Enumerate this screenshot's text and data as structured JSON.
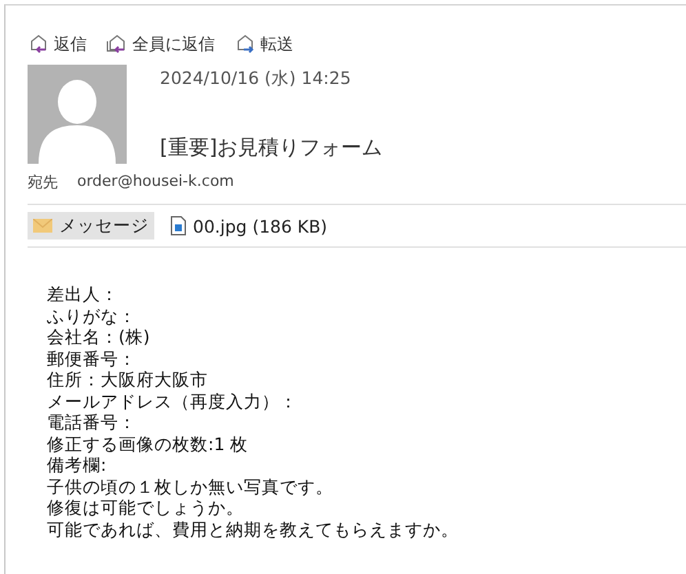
{
  "toolbar": [
    {
      "kind": "reply",
      "label": "返信"
    },
    {
      "kind": "reply_all",
      "label": "全員に返信"
    },
    {
      "kind": "forward",
      "label": "転送"
    }
  ],
  "message": {
    "date": "2024/10/16 (水) 14:25",
    "subject": "[重要]お見積りフォーム",
    "to_label": "宛先",
    "to": "order@housei-k.com"
  },
  "attachments": [
    {
      "kind": "message",
      "label": "メッセージ",
      "selected": true
    },
    {
      "kind": "file",
      "label": "00.jpg (186 KB)",
      "selected": false
    }
  ],
  "body": [
    "差出人：",
    "ふりがな：",
    "会社名：(株)",
    "郵便番号：",
    "住所：大阪府大阪市",
    "メールアドレス（再度入力）：",
    "電話番号：",
    "修正する画像の枚数:1 枚",
    "備考欄:",
    "子供の頃の１枚しか無い写真です。",
    "修復は可能でしょうか。",
    "可能であれば、費用と納期を教えてもらえますか。"
  ]
}
